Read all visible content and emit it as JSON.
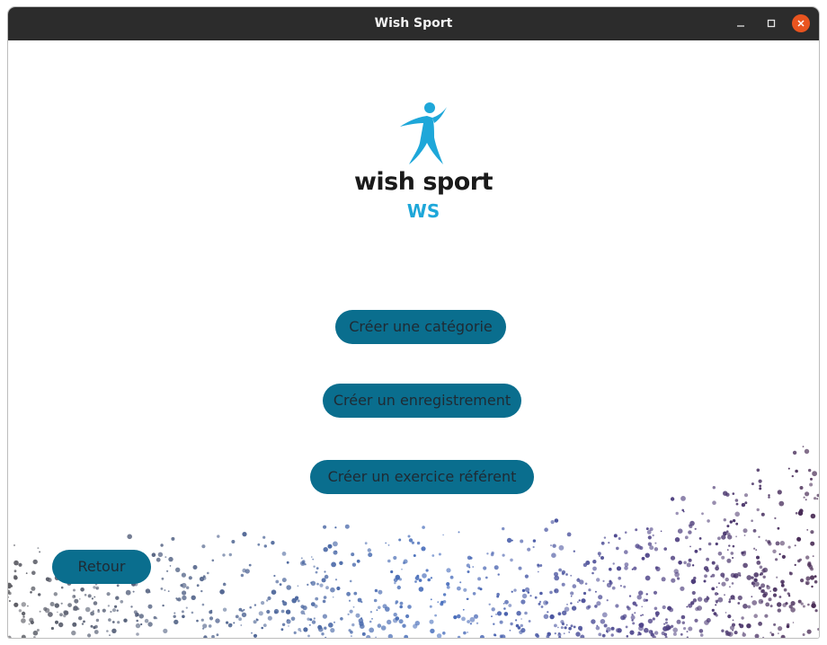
{
  "window": {
    "title": "Wish Sport",
    "controls": {
      "minimize_icon": "minimize-icon",
      "maximize_icon": "maximize-icon",
      "close_icon": "close-icon"
    }
  },
  "logo": {
    "brand_text": "wish sport",
    "monogram": "WS",
    "figure_icon": "athlete-figure-icon"
  },
  "actions": {
    "create_category": "Créer une catégorie",
    "create_record": "Créer un enregistrement",
    "create_exercise": "Créer un exercice référent",
    "back": "Retour"
  },
  "colors": {
    "titlebar": "#2c2c2c",
    "button": "#0a6e8e",
    "button_text": "#1f2a33",
    "logo_blue": "#1ea7d9",
    "close": "#e9541f"
  }
}
